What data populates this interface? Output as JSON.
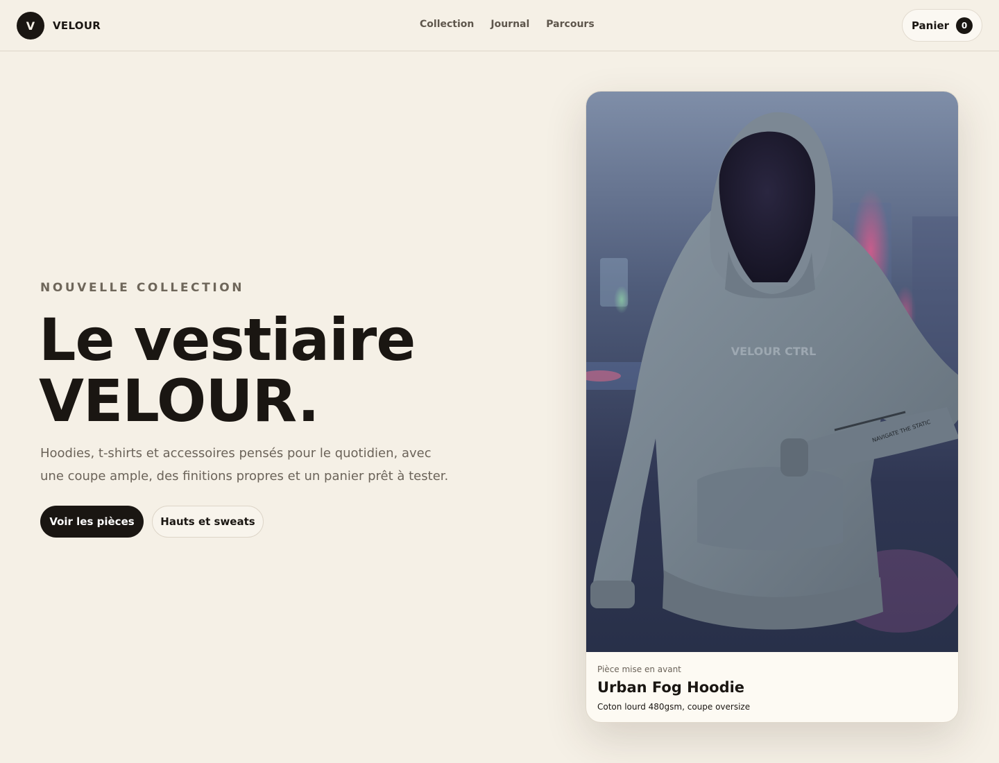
{
  "header": {
    "logo_letter": "V",
    "brand": "VELOUR",
    "nav": [
      {
        "label": "Collection"
      },
      {
        "label": "Journal"
      },
      {
        "label": "Parcours"
      }
    ],
    "cart_label": "Panier",
    "cart_count": "0"
  },
  "hero": {
    "eyebrow": "NOUVELLE COLLECTION",
    "headline_line1": "Le vestiaire",
    "headline_line2": "VELOUR.",
    "lede": "Hoodies, t-shirts et accessoires pensés pour le quotidien, avec une coupe ample, des finitions propres et un panier prêt à tester.",
    "primary_button": "Voir les pièces",
    "secondary_button": "Hauts et sweats"
  },
  "featured": {
    "kicker": "Pièce mise en avant",
    "title": "Urban Fog Hoodie",
    "subtitle": "Coton lourd 480gsm, coupe oversize",
    "print_chest": "VELOUR CTRL",
    "print_sleeve": "NAVIGATE THE STATIC"
  },
  "colors": {
    "background": "#f5f0e6",
    "ink": "#1a1612",
    "muted": "#6b6359",
    "hoodie": "#77848f"
  }
}
